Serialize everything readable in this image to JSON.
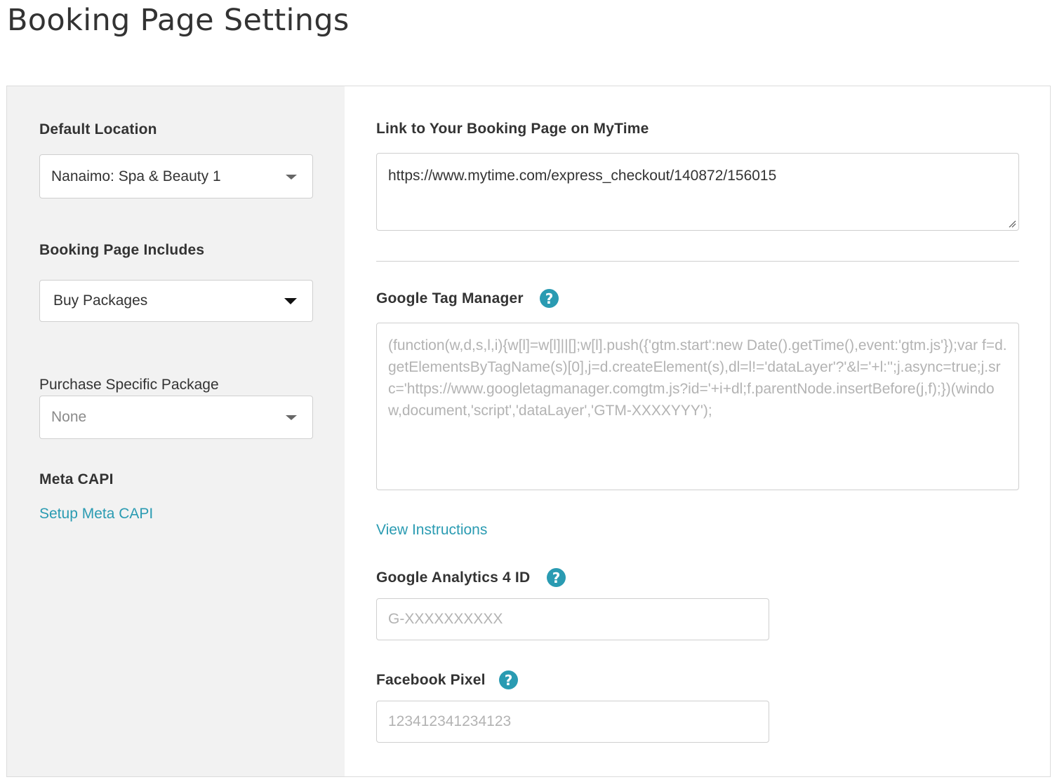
{
  "page": {
    "title": "Booking Page Settings"
  },
  "sidebar": {
    "default_location": {
      "label": "Default Location",
      "value": "Nanaimo: Spa & Beauty 1"
    },
    "booking_page_includes": {
      "label": "Booking Page Includes",
      "value": "Buy Packages"
    },
    "purchase_specific_package": {
      "label": "Purchase Specific Package",
      "value": "None"
    },
    "meta_capi": {
      "label": "Meta CAPI",
      "link": "Setup Meta CAPI"
    }
  },
  "main": {
    "booking_link": {
      "label": "Link to Your Booking Page on MyTime",
      "value": "https://www.mytime.com/express_checkout/140872/156015"
    },
    "gtm": {
      "label": "Google Tag Manager",
      "help_icon": "question-circle-icon",
      "placeholder": "(function(w,d,s,l,i){w[l]=w[l]||[];w[l].push({'gtm.start':new Date().getTime(),event:'gtm.js'});var f=d.getElementsByTagName(s)[0],j=d.createElement(s),dl=l!='dataLayer'?'&l='+l:'';j.async=true;j.src='https://www.googletagmanager.comgtm.js?id='+i+dl;f.parentNode.insertBefore(j,f);})(window,document,'script','dataLayer','GTM-XXXXYYY');",
      "instructions_link": "View Instructions"
    },
    "ga4": {
      "label": "Google Analytics 4 ID",
      "help_icon": "question-circle-icon",
      "placeholder": "G-XXXXXXXXXX"
    },
    "facebook_pixel": {
      "label": "Facebook Pixel",
      "help_icon": "question-circle-icon",
      "placeholder": "123412341234123"
    }
  },
  "colors": {
    "accent": "#2a9bb2",
    "sidebar_bg": "#f2f2f2",
    "border": "#cfcfcf"
  }
}
